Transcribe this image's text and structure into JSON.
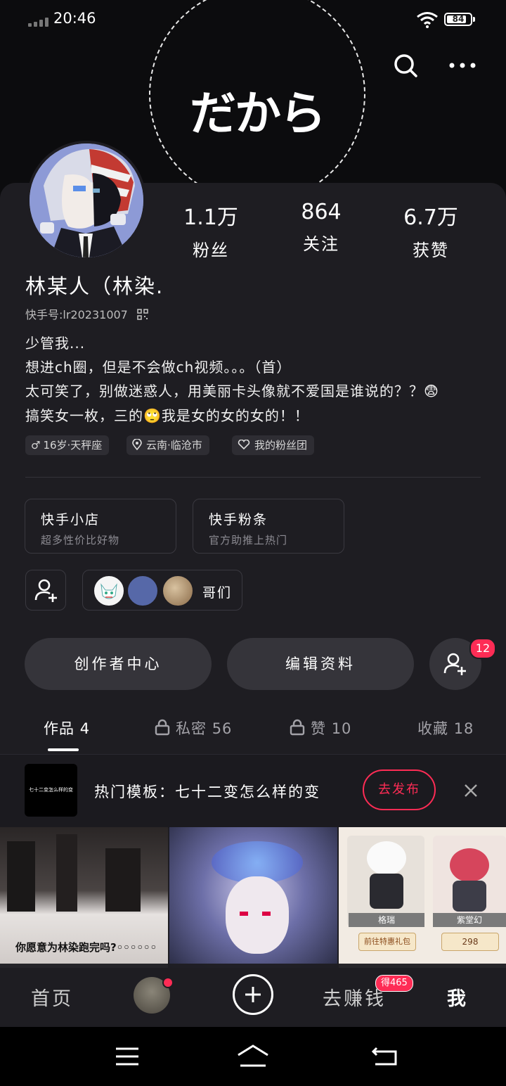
{
  "status_bar": {
    "time": "20:46",
    "battery_level": "84",
    "battery_fraction": 0.84
  },
  "cover": {
    "text": "だから"
  },
  "profile": {
    "stats": [
      {
        "value": "1.1万",
        "label": "粉丝"
      },
      {
        "value": "864",
        "label": "关注"
      },
      {
        "value": "6.7万",
        "label": "获赞"
      }
    ],
    "name": "林某人（林染.",
    "kuaishou_id": "快手号:lr20231007",
    "bio_lines": [
      "少管我...",
      "想进ch圈，但是不会做ch视频。。。（首）",
      "太可笑了，别做迷惑人，用美丽卡头像就不爱国是谁说的？？😨",
      "搞笑女一枚，三的🙄我是女的女的女的！！"
    ],
    "tags": [
      "16岁·天秤座",
      "云南·临沧市",
      "我的粉丝团"
    ]
  },
  "cards": [
    {
      "title": "快手小店",
      "subtitle": "超多性价比好物"
    },
    {
      "title": "快手粉条",
      "subtitle": "官方助推上热门"
    }
  ],
  "group": {
    "label": "哥们"
  },
  "actions": {
    "creator_center": "创作者中心",
    "edit_profile": "编辑资料",
    "follow_badge": "12"
  },
  "tabs": [
    {
      "label": "作品",
      "count": "4"
    },
    {
      "label": "私密",
      "count": "56"
    },
    {
      "label": "赞",
      "count": "10"
    },
    {
      "label": "收藏",
      "count": "18"
    }
  ],
  "promo": {
    "thumb_text": "七十二变怎么样的变",
    "text": "热门模板：七十二变怎么样的变",
    "button": "去发布"
  },
  "grid": {
    "thumb1_caption": "你愿意为林染跑完吗?◦◦◦◦◦◦",
    "thumb3_labels": [
      "格瑞",
      "紫堂幻",
      "前往特惠礼包",
      "298"
    ]
  },
  "bottom_nav": {
    "home": "首页",
    "earn": "去赚钱",
    "earn_badge": "得465",
    "me": "我"
  }
}
